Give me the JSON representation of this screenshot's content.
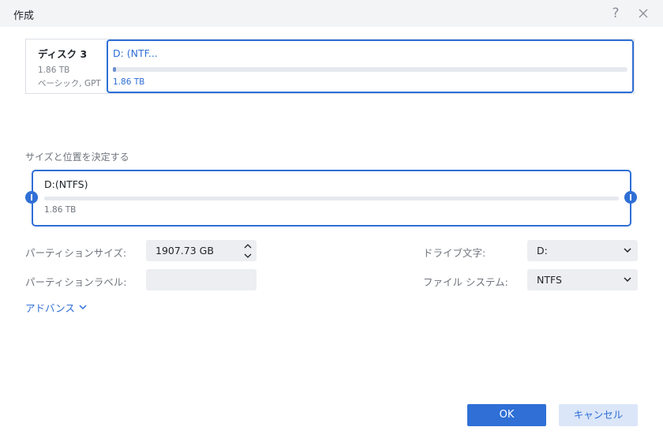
{
  "window": {
    "title": "作成",
    "help_label": "?"
  },
  "disk": {
    "name": "ディスク 3",
    "size": "1.86 TB",
    "type": "ベーシック, GPT",
    "partition": {
      "name": "D: (NTF...",
      "size": "1.86 TB",
      "used_fraction": 0.005
    }
  },
  "layout_section": {
    "title": "サイズと位置を決定する",
    "partition_name": "D:(NTFS)",
    "partition_size": "1.86 TB"
  },
  "form": {
    "partition_size_label": "パーティションサイズ:",
    "partition_size_value": "1907.73 GB",
    "partition_label_label": "パーティションラベル:",
    "partition_label_value": "",
    "drive_letter_label": "ドライブ文字:",
    "drive_letter_value": "D:",
    "file_system_label": "ファイル システム:",
    "file_system_value": "NTFS",
    "advanced_label": "アドバンス"
  },
  "buttons": {
    "ok": "OK",
    "cancel": "キャンセル"
  },
  "colors": {
    "accent": "#2f6fd6",
    "titlebar": "#f3f4f6",
    "field_bg": "#eceef1"
  }
}
